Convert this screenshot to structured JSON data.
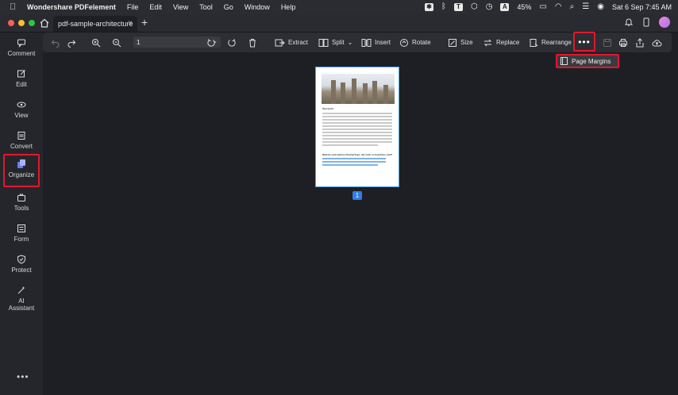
{
  "menubar": {
    "app_name": "Wondershare PDFelement",
    "items": [
      "File",
      "Edit",
      "View",
      "Tool",
      "Go",
      "Window",
      "Help"
    ],
    "battery": "45%",
    "datetime": "Sat 6 Sep  7:45 AM",
    "tray_letter_a": "A"
  },
  "tabbar": {
    "tab_title": "pdf-sample-architecture",
    "close_glyph": "×",
    "new_tab_glyph": "+"
  },
  "sidebar": {
    "items": [
      {
        "label": "Comment",
        "icon": "comment-icon"
      },
      {
        "label": "Edit",
        "icon": "edit-icon"
      },
      {
        "label": "View",
        "icon": "view-icon"
      },
      {
        "label": "Convert",
        "icon": "convert-icon"
      },
      {
        "label": "Organize",
        "icon": "organize-icon",
        "active": true
      },
      {
        "label": "Tools",
        "icon": "tools-icon"
      },
      {
        "label": "Form",
        "icon": "form-icon"
      },
      {
        "label": "Protect",
        "icon": "protect-icon"
      },
      {
        "label": "AI",
        "icon": "ai-assistant-icon"
      }
    ],
    "ai_label_line2": "Assistant",
    "more_glyph": "•••"
  },
  "toolbar": {
    "page_value": "1",
    "extract": "Extract",
    "split": "Split",
    "insert": "Insert",
    "rotate": "Rotate",
    "size": "Size",
    "replace": "Replace",
    "rearrange": "Rearrange",
    "more_glyph": "•••"
  },
  "popup": {
    "page_margins": "Page Margins"
  },
  "page": {
    "number": "1",
    "heading": "Übersicht",
    "subheading": "Welche sind weitere Punkte/Tops, die noch zu beachten sind?"
  },
  "colors": {
    "accent_red": "#e2172c",
    "page_badge": "#2f7de1"
  }
}
